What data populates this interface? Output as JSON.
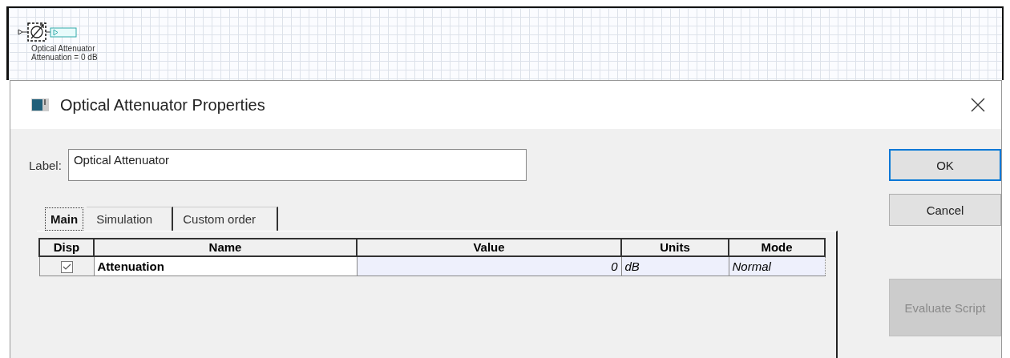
{
  "canvas": {
    "component": {
      "name": "Optical Attenuator",
      "parameter": "Attenuation = 0  dB",
      "selected": true
    }
  },
  "dialog": {
    "title": "Optical Attenuator Properties",
    "label_field": {
      "label": "Label:",
      "value": "Optical Attenuator"
    },
    "tabs": [
      {
        "label": "Main",
        "selected": true
      },
      {
        "label": "Simulation",
        "selected": false
      },
      {
        "label": "Custom order",
        "selected": false
      }
    ],
    "table": {
      "columns": [
        "Disp",
        "Name",
        "Value",
        "Units",
        "Mode"
      ],
      "rows": [
        {
          "disp": true,
          "name": "Attenuation",
          "value": "0",
          "units": "dB",
          "mode": "Normal"
        }
      ]
    },
    "buttons": [
      {
        "label": "OK",
        "default": true,
        "disabled": false
      },
      {
        "label": "Cancel",
        "default": false,
        "disabled": false
      },
      {
        "label": "Evaluate Script",
        "default": false,
        "disabled": true
      }
    ]
  }
}
